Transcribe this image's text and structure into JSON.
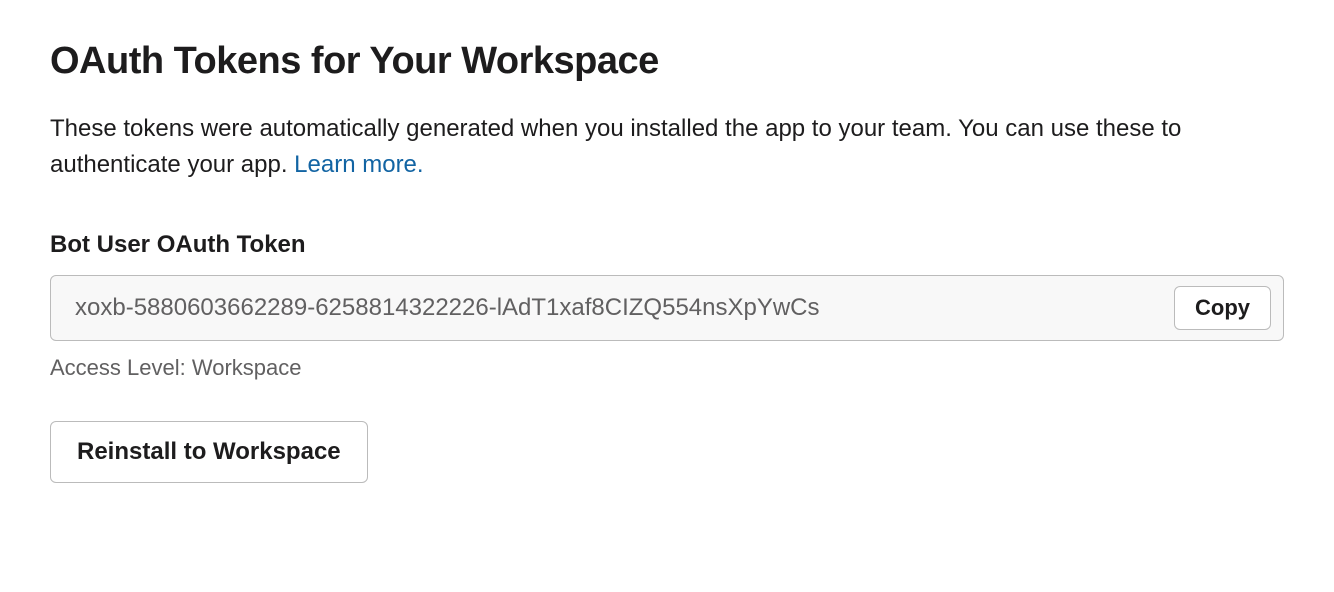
{
  "heading": "OAuth Tokens for Your Workspace",
  "description_text": "These tokens were automatically generated when you installed the app to your team. You can use these to authenticate your app. ",
  "learn_more_label": "Learn more.",
  "token_section": {
    "label": "Bot User OAuth Token",
    "value": "xoxb-5880603662289-6258814322226-lAdT1xaf8CIZQ554nsXpYwCs",
    "copy_label": "Copy",
    "access_level": "Access Level: Workspace"
  },
  "reinstall_label": "Reinstall to Workspace"
}
